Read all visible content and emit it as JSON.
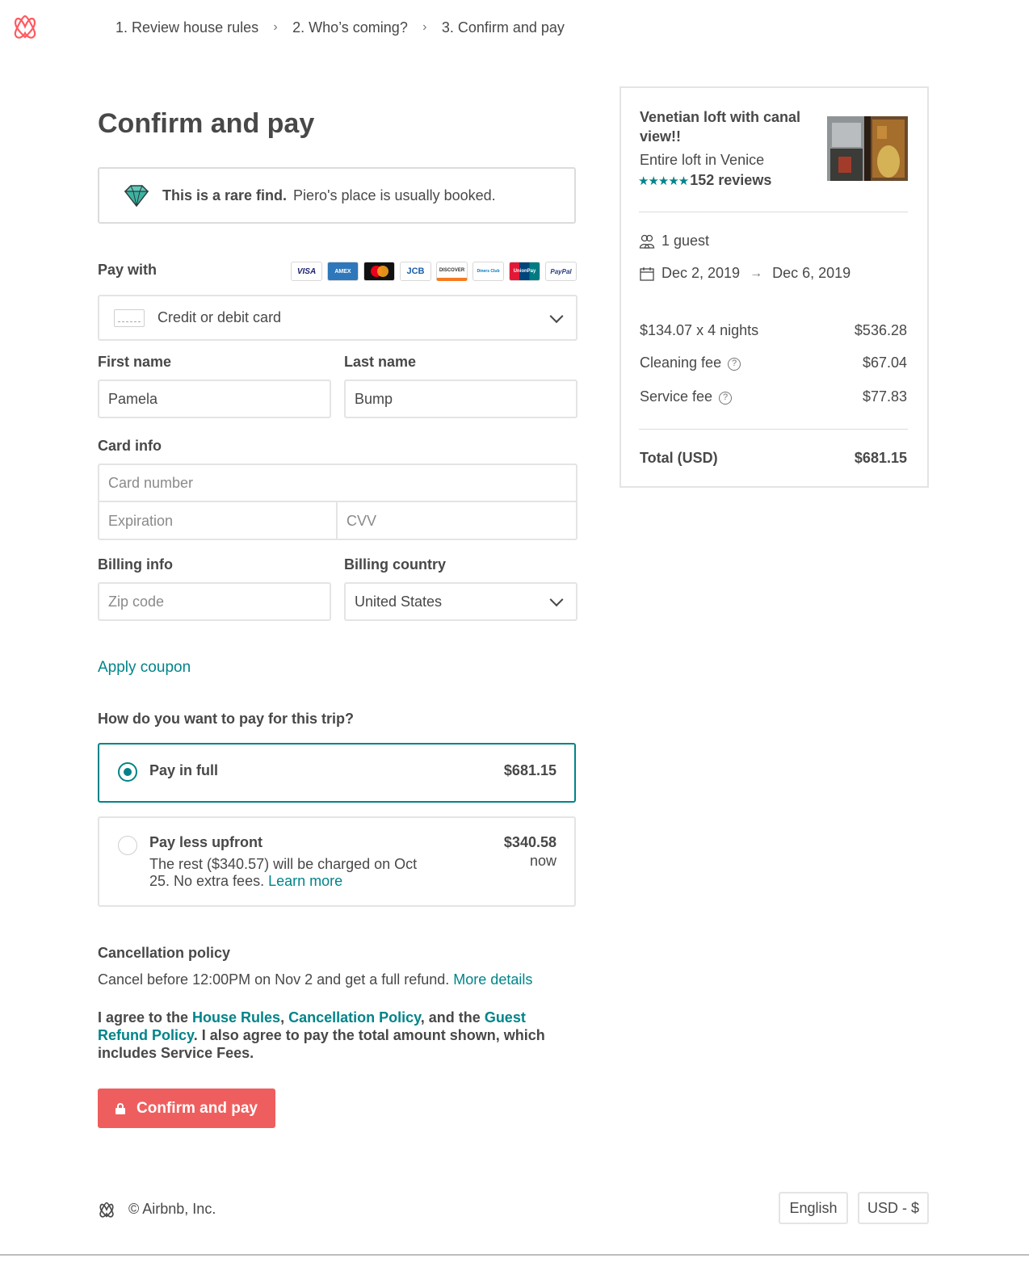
{
  "header": {
    "steps": [
      "1. Review house rules",
      "2. Who’s coming?",
      "3. Confirm and pay"
    ]
  },
  "main": {
    "title": "Confirm and pay",
    "rare": {
      "bold": "This is a rare find.",
      "text": "Piero's place is usually booked."
    },
    "pay_with": {
      "label": "Pay with",
      "card_brands": [
        "VISA",
        "AMEX",
        "mastercard",
        "JCB",
        "DISCOVER",
        "Diners Club",
        "UnionPay",
        "PayPal"
      ],
      "method": "Credit or debit card"
    },
    "first_name": {
      "label": "First name",
      "value": "Pamela"
    },
    "last_name": {
      "label": "Last name",
      "value": "Bump"
    },
    "card_info": {
      "label": "Card info",
      "number_placeholder": "Card number",
      "expiration_placeholder": "Expiration",
      "cvv_placeholder": "CVV"
    },
    "billing_info": {
      "label": "Billing info",
      "zip_placeholder": "Zip code"
    },
    "billing_country": {
      "label": "Billing country",
      "value": "United States"
    },
    "apply_coupon": "Apply coupon",
    "payment_question": "How do you want to pay for this trip?",
    "options": {
      "full": {
        "title": "Pay in full",
        "price": "$681.15"
      },
      "less": {
        "title": "Pay less upfront",
        "price": "$340.58",
        "now": "now",
        "sub": "The rest ($340.57) will be charged on Oct 25. No extra fees.",
        "learn_more": "Learn more"
      }
    },
    "cancellation": {
      "heading": "Cancellation policy",
      "text": "Cancel before 12:00PM on Nov 2 and get a full refund.",
      "more": "More details"
    },
    "agree": {
      "pre": "I agree to the ",
      "house_rules": "House Rules",
      "comma": ", ",
      "cancel_policy": "Cancellation Policy",
      "and": ", and the ",
      "refund_policy": "Guest Refund Policy",
      "post": ". I also agree to pay the total amount shown, which includes Service Fees."
    },
    "confirm_button": "Confirm and pay"
  },
  "sidebar": {
    "listing_title": "Venetian loft with canal view!!",
    "listing_sub": "Entire loft in Venice",
    "stars": "★★★★★",
    "reviews": "152 reviews",
    "guests": "1 guest",
    "check_in": "Dec 2, 2019",
    "check_out": "Dec 6, 2019",
    "fees": [
      {
        "label": "$134.07 x 4 nights",
        "amount": "$536.28"
      },
      {
        "label": "Cleaning fee",
        "amount": "$67.04"
      },
      {
        "label": "Service fee",
        "amount": "$77.83"
      }
    ],
    "total_label": "Total (USD)",
    "total_amount": "$681.15"
  },
  "footer": {
    "copyright": "© Airbnb, Inc.",
    "language": "English",
    "currency": "USD - $"
  },
  "colors": {
    "accent": "#008489",
    "brand": "#FF5A5F",
    "button": "#EF5E5E"
  }
}
